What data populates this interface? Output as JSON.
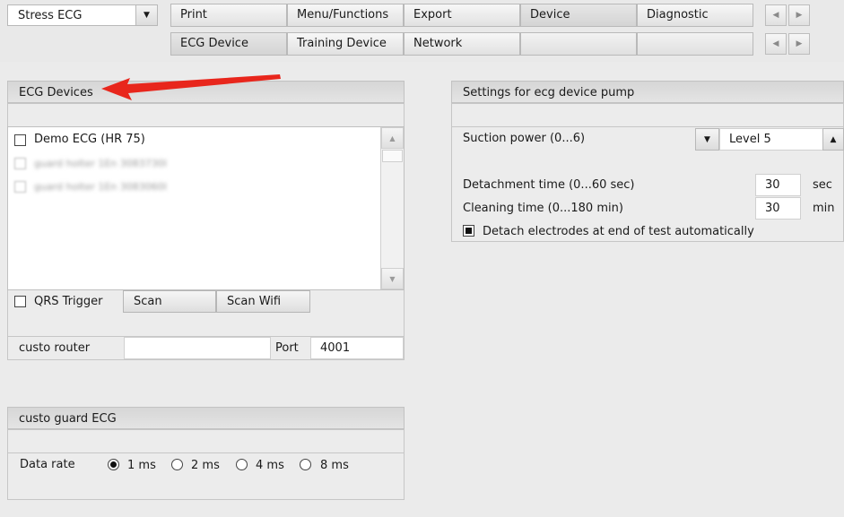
{
  "profile": {
    "value": "Stress ECG"
  },
  "tabs_row1": [
    {
      "label": "Print",
      "active": false
    },
    {
      "label": "Menu/Functions",
      "active": false
    },
    {
      "label": "Export",
      "active": false
    },
    {
      "label": "Device",
      "active": true
    },
    {
      "label": "Diagnostic",
      "active": false
    }
  ],
  "tabs_row2": [
    {
      "label": "ECG Device",
      "active": true
    },
    {
      "label": "Training Device",
      "active": false
    },
    {
      "label": "Network",
      "active": false
    },
    {
      "label": "",
      "active": false
    },
    {
      "label": "",
      "active": false
    }
  ],
  "ecg_devices": {
    "title": "ECG Devices",
    "devices": [
      {
        "label": "Demo ECG (HR 75)",
        "checked": false
      },
      {
        "label": "guard holter 1En 3083730I",
        "checked": false,
        "blurred": true
      },
      {
        "label": "guard holter 1En 3083060I",
        "checked": false,
        "blurred": true
      }
    ],
    "qrs_trigger": {
      "label": "QRS Trigger",
      "checked": false
    },
    "scan_label": "Scan",
    "scan_wifi_label": "Scan Wifi",
    "router_label": "custo router",
    "router_value": "",
    "port_label": "Port",
    "port_value": "4001"
  },
  "guard_ecg": {
    "title": "custo guard ECG",
    "data_rate_label": "Data rate",
    "options": [
      {
        "label": "1 ms",
        "checked": true
      },
      {
        "label": "2 ms",
        "checked": false
      },
      {
        "label": "4 ms",
        "checked": false
      },
      {
        "label": "8 ms",
        "checked": false
      }
    ]
  },
  "pump": {
    "title": "Settings for ecg device pump",
    "suction_label": "Suction power (0...6)",
    "suction_value": "Level 5",
    "detachment_label": "Detachment time (0...60 sec)",
    "detachment_value": "30",
    "detachment_unit": "sec",
    "cleaning_label": "Cleaning time (0...180 min)",
    "cleaning_value": "30",
    "cleaning_unit": "min",
    "detach_auto_label": "Detach electrodes at end of test automatically",
    "detach_auto_checked": true
  },
  "annotation_arrow_color": "#e8261c"
}
